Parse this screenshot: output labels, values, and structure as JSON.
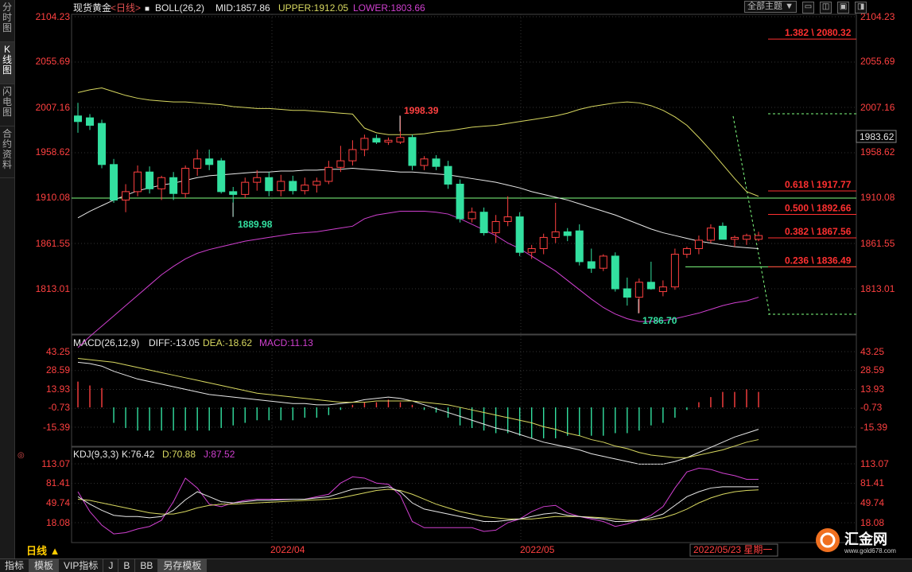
{
  "sidebar": {
    "tabs": [
      {
        "label": "分时图",
        "active": false
      },
      {
        "label": "K线图",
        "active": true
      },
      {
        "label": "闪电图",
        "active": false
      },
      {
        "label": "合约资料",
        "active": false
      }
    ]
  },
  "header": {
    "instrument": "现货黄金",
    "period": "<日线>",
    "boll_label": "BOLL(26,2)",
    "mid": "MID:1857.86",
    "upper": "UPPER:1912.05",
    "lower": "LOWER:1803.66",
    "theme_dropdown": "全部主题"
  },
  "window_buttons": {
    "minimize": "▭",
    "restore": "◫",
    "maximize": "▣",
    "close": "◨"
  },
  "colors": {
    "up": "#ff4040",
    "down": "#33e0a0",
    "mid": "#e8e8e8",
    "upper": "#d8d860",
    "lower": "#d040d0",
    "fib": "#ff3030",
    "grid": "#333333",
    "hline": "#80ff80",
    "axis_text": "#ff4040",
    "macd_text": "#ff4040"
  },
  "price_axis": [
    "2104.23",
    "2055.69",
    "2007.16",
    "1958.62",
    "1910.08",
    "1861.55",
    "1813.01"
  ],
  "current_price": "1983.62",
  "annotations": {
    "high": "1998.39",
    "low1": "1889.98",
    "low2": "1786.70"
  },
  "fib_levels": [
    {
      "label": "1.382 \\ 2080.32",
      "price": 2080.32,
      "solid": true
    },
    {
      "label": "0.618 \\ 1917.77",
      "price": 1917.77,
      "solid": true
    },
    {
      "label": "0.500 \\ 1892.66",
      "price": 1892.66,
      "solid": true
    },
    {
      "label": "0.382 \\ 1867.56",
      "price": 1867.56,
      "solid": true
    },
    {
      "label": "0.236 \\ 1836.49",
      "price": 1836.49,
      "solid": true
    }
  ],
  "macd_header": {
    "name": "MACD(26,12,9)",
    "diff": "DIFF:-13.05",
    "dea": "DEA:-18.62",
    "macd": "MACD:11.13"
  },
  "macd_axis": [
    "43.25",
    "28.59",
    "13.93",
    "-0.73",
    "-15.39"
  ],
  "kdj_header": {
    "name": "KDJ(9,3,3)",
    "k": "K:76.42",
    "d": "D:70.88",
    "j": "J:87.52"
  },
  "kdj_axis": [
    "113.07",
    "81.41",
    "49.74",
    "18.08"
  ],
  "date_axis": {
    "period_label": "日线 ▲",
    "months": [
      "2022/04",
      "2022/05"
    ],
    "cursor_date": "2022/05/23 星期一"
  },
  "bottom_tabs": [
    {
      "label": "指标",
      "selected": false
    },
    {
      "label": "模板",
      "selected": true
    },
    {
      "label": "VIP指标",
      "selected": false
    },
    {
      "label": "J",
      "selected": false
    },
    {
      "label": "B",
      "selected": false
    },
    {
      "label": "BB",
      "selected": false
    },
    {
      "label": "另存模板",
      "selected": true
    }
  ],
  "logo": {
    "text": "汇金网",
    "url_text": "www.gold678.com"
  },
  "chart_data": {
    "type": "candlestick",
    "title": "现货黄金 <日线>",
    "ylim": [
      1780,
      2110
    ],
    "candles": [
      {
        "o": 1998,
        "h": 2012,
        "l": 1980,
        "c": 1992
      },
      {
        "o": 1996,
        "h": 2000,
        "l": 1983,
        "c": 1988
      },
      {
        "o": 1990,
        "h": 1994,
        "l": 1942,
        "c": 1946
      },
      {
        "o": 1946,
        "h": 1952,
        "l": 1905,
        "c": 1908
      },
      {
        "o": 1908,
        "h": 1925,
        "l": 1895,
        "c": 1917
      },
      {
        "o": 1917,
        "h": 1945,
        "l": 1912,
        "c": 1938
      },
      {
        "o": 1938,
        "h": 1944,
        "l": 1915,
        "c": 1920
      },
      {
        "o": 1920,
        "h": 1934,
        "l": 1908,
        "c": 1932
      },
      {
        "o": 1932,
        "h": 1938,
        "l": 1908,
        "c": 1915
      },
      {
        "o": 1915,
        "h": 1945,
        "l": 1910,
        "c": 1942
      },
      {
        "o": 1942,
        "h": 1962,
        "l": 1934,
        "c": 1952
      },
      {
        "o": 1952,
        "h": 1962,
        "l": 1940,
        "c": 1946
      },
      {
        "o": 1950,
        "h": 1953,
        "l": 1915,
        "c": 1917
      },
      {
        "o": 1917,
        "h": 1922,
        "l": 1890,
        "c": 1914
      },
      {
        "o": 1914,
        "h": 1932,
        "l": 1910,
        "c": 1927
      },
      {
        "o": 1927,
        "h": 1940,
        "l": 1918,
        "c": 1932
      },
      {
        "o": 1932,
        "h": 1938,
        "l": 1912,
        "c": 1918
      },
      {
        "o": 1918,
        "h": 1935,
        "l": 1912,
        "c": 1928
      },
      {
        "o": 1928,
        "h": 1934,
        "l": 1914,
        "c": 1918
      },
      {
        "o": 1918,
        "h": 1932,
        "l": 1914,
        "c": 1924
      },
      {
        "o": 1924,
        "h": 1932,
        "l": 1916,
        "c": 1928
      },
      {
        "o": 1928,
        "h": 1950,
        "l": 1925,
        "c": 1943
      },
      {
        "o": 1943,
        "h": 1966,
        "l": 1938,
        "c": 1950
      },
      {
        "o": 1950,
        "h": 1972,
        "l": 1945,
        "c": 1962
      },
      {
        "o": 1962,
        "h": 1978,
        "l": 1955,
        "c": 1974
      },
      {
        "o": 1974,
        "h": 1978,
        "l": 1968,
        "c": 1970
      },
      {
        "o": 1970,
        "h": 1975,
        "l": 1967,
        "c": 1972
      },
      {
        "o": 1970,
        "h": 1998,
        "l": 1968,
        "c": 1975
      },
      {
        "o": 1975,
        "h": 1978,
        "l": 1940,
        "c": 1945
      },
      {
        "o": 1945,
        "h": 1955,
        "l": 1940,
        "c": 1952
      },
      {
        "o": 1952,
        "h": 1956,
        "l": 1940,
        "c": 1944
      },
      {
        "o": 1944,
        "h": 1950,
        "l": 1920,
        "c": 1925
      },
      {
        "o": 1925,
        "h": 1930,
        "l": 1884,
        "c": 1888
      },
      {
        "o": 1888,
        "h": 1900,
        "l": 1884,
        "c": 1895
      },
      {
        "o": 1895,
        "h": 1900,
        "l": 1870,
        "c": 1873
      },
      {
        "o": 1873,
        "h": 1892,
        "l": 1862,
        "c": 1885
      },
      {
        "o": 1885,
        "h": 1912,
        "l": 1880,
        "c": 1890
      },
      {
        "o": 1890,
        "h": 1895,
        "l": 1848,
        "c": 1852
      },
      {
        "o": 1852,
        "h": 1860,
        "l": 1845,
        "c": 1856
      },
      {
        "o": 1856,
        "h": 1872,
        "l": 1850,
        "c": 1868
      },
      {
        "o": 1868,
        "h": 1905,
        "l": 1862,
        "c": 1874
      },
      {
        "o": 1874,
        "h": 1878,
        "l": 1864,
        "c": 1870
      },
      {
        "o": 1875,
        "h": 1882,
        "l": 1838,
        "c": 1842
      },
      {
        "o": 1842,
        "h": 1856,
        "l": 1830,
        "c": 1835
      },
      {
        "o": 1835,
        "h": 1850,
        "l": 1832,
        "c": 1848
      },
      {
        "o": 1848,
        "h": 1852,
        "l": 1810,
        "c": 1813
      },
      {
        "o": 1813,
        "h": 1825,
        "l": 1795,
        "c": 1804
      },
      {
        "o": 1804,
        "h": 1824,
        "l": 1787,
        "c": 1820
      },
      {
        "o": 1820,
        "h": 1842,
        "l": 1812,
        "c": 1813
      },
      {
        "o": 1810,
        "h": 1822,
        "l": 1805,
        "c": 1815
      },
      {
        "o": 1815,
        "h": 1856,
        "l": 1812,
        "c": 1850
      },
      {
        "o": 1850,
        "h": 1858,
        "l": 1846,
        "c": 1856
      },
      {
        "o": 1856,
        "h": 1870,
        "l": 1850,
        "c": 1865
      },
      {
        "o": 1865,
        "h": 1882,
        "l": 1862,
        "c": 1878
      },
      {
        "o": 1880,
        "h": 1884,
        "l": 1868,
        "c": 1866
      },
      {
        "o": 1866,
        "h": 1870,
        "l": 1858,
        "c": 1868
      },
      {
        "o": 1866,
        "h": 1872,
        "l": 1860,
        "c": 1870
      },
      {
        "o": 1866,
        "h": 1874,
        "l": 1864,
        "c": 1870
      }
    ],
    "mid": [
      1889,
      1896,
      1902,
      1908,
      1913,
      1918,
      1921,
      1924,
      1926,
      1929,
      1932,
      1934,
      1935,
      1936,
      1937,
      1938,
      1938,
      1939,
      1939,
      1940,
      1940,
      1941,
      1941,
      1942,
      1941,
      1940,
      1939,
      1938,
      1938,
      1937,
      1936,
      1935,
      1933,
      1931,
      1929,
      1927,
      1924,
      1921,
      1917,
      1914,
      1911,
      1908,
      1904,
      1900,
      1896,
      1892,
      1887,
      1882,
      1877,
      1873,
      1870,
      1867,
      1864,
      1862,
      1860,
      1858,
      1857,
      1856
    ],
    "upper": [
      2023,
      2026,
      2028,
      2024,
      2020,
      2017,
      2015,
      2014,
      2013,
      2013,
      2012,
      2011,
      2010,
      2008,
      2007,
      2006,
      2006,
      2005,
      2004,
      2004,
      2003,
      2002,
      2001,
      2000,
      1985,
      1980,
      1978,
      1978,
      1978,
      1979,
      1981,
      1982,
      1984,
      1986,
      1987,
      1988,
      1990,
      1992,
      1994,
      1996,
      1998,
      2001,
      2005,
      2008,
      2010,
      2012,
      2013,
      2012,
      2009,
      2004,
      1997,
      1988,
      1975,
      1961,
      1946,
      1931,
      1917,
      1912
    ],
    "lower": [
      1750,
      1762,
      1773,
      1784,
      1795,
      1806,
      1817,
      1828,
      1837,
      1845,
      1851,
      1855,
      1858,
      1861,
      1864,
      1866,
      1868,
      1870,
      1872,
      1873,
      1874,
      1876,
      1878,
      1880,
      1888,
      1892,
      1894,
      1896,
      1896,
      1896,
      1895,
      1893,
      1888,
      1882,
      1876,
      1870,
      1862,
      1856,
      1848,
      1840,
      1832,
      1822,
      1812,
      1802,
      1793,
      1786,
      1781,
      1778,
      1778,
      1779,
      1781,
      1784,
      1787,
      1791,
      1795,
      1798,
      1800,
      1804
    ],
    "macd": {
      "diff": [
        35,
        34,
        32,
        28,
        25,
        22,
        20,
        18,
        16,
        14,
        12,
        10,
        9,
        8,
        7,
        6,
        5,
        4,
        3,
        3,
        2,
        2,
        3,
        4,
        6,
        7,
        8,
        7,
        5,
        2,
        -1,
        -4,
        -7,
        -10,
        -13,
        -16,
        -18,
        -21,
        -24,
        -27,
        -29,
        -31,
        -33,
        -36,
        -38,
        -40,
        -42,
        -44,
        -44,
        -44,
        -42,
        -39,
        -35,
        -31,
        -27,
        -23,
        -20,
        -17
      ],
      "dea": [
        38,
        37,
        36,
        35,
        33,
        31,
        29,
        27,
        25,
        23,
        21,
        19,
        17,
        15,
        13,
        11,
        10,
        9,
        8,
        7,
        6,
        5,
        4,
        4,
        4,
        5,
        5,
        5,
        5,
        4,
        3,
        2,
        0,
        -2,
        -4,
        -6,
        -8,
        -10,
        -12,
        -15,
        -17,
        -20,
        -22,
        -25,
        -27,
        -30,
        -32,
        -35,
        -37,
        -38,
        -39,
        -39,
        -37,
        -35,
        -33,
        -30,
        -27,
        -25
      ],
      "macd": [
        20,
        17,
        15,
        -12,
        -16,
        -18,
        -18,
        -18,
        -18,
        -18,
        -18,
        -18,
        -16,
        -14,
        -12,
        -10,
        -10,
        -10,
        -10,
        -8,
        -8,
        -6,
        -2,
        2,
        4,
        4,
        6,
        4,
        2,
        -2,
        -4,
        -8,
        -14,
        -16,
        -18,
        -20,
        -20,
        -22,
        -24,
        -24,
        -24,
        -22,
        -22,
        -22,
        -22,
        -20,
        -20,
        -18,
        -14,
        -12,
        -8,
        -2,
        4,
        8,
        12,
        12,
        14,
        12
      ]
    },
    "kdj": {
      "k": [
        60,
        48,
        38,
        30,
        28,
        28,
        26,
        28,
        38,
        55,
        68,
        60,
        52,
        50,
        52,
        54,
        54,
        55,
        56,
        56,
        58,
        60,
        66,
        72,
        74,
        74,
        76,
        68,
        50,
        40,
        36,
        32,
        28,
        24,
        20,
        20,
        22,
        24,
        28,
        32,
        34,
        30,
        28,
        26,
        24,
        20,
        20,
        22,
        26,
        32,
        46,
        60,
        68,
        74,
        76,
        76,
        76,
        76
      ],
      "d": [
        56,
        54,
        50,
        46,
        42,
        38,
        34,
        32,
        32,
        36,
        42,
        46,
        48,
        48,
        49,
        50,
        51,
        52,
        53,
        54,
        55,
        56,
        58,
        62,
        66,
        70,
        72,
        70,
        64,
        56,
        48,
        42,
        36,
        32,
        28,
        26,
        24,
        24,
        24,
        26,
        28,
        28,
        28,
        27,
        26,
        24,
        22,
        22,
        23,
        26,
        32,
        40,
        50,
        58,
        64,
        68,
        70,
        71
      ],
      "j": [
        68,
        36,
        14,
        0,
        2,
        8,
        12,
        22,
        52,
        90,
        74,
        48,
        44,
        50,
        54,
        56,
        56,
        56,
        56,
        56,
        60,
        64,
        82,
        92,
        90,
        82,
        80,
        62,
        20,
        10,
        10,
        10,
        10,
        10,
        4,
        6,
        18,
        24,
        36,
        44,
        46,
        34,
        28,
        24,
        20,
        12,
        16,
        22,
        30,
        44,
        74,
        100,
        106,
        104,
        98,
        94,
        88,
        88
      ]
    }
  }
}
